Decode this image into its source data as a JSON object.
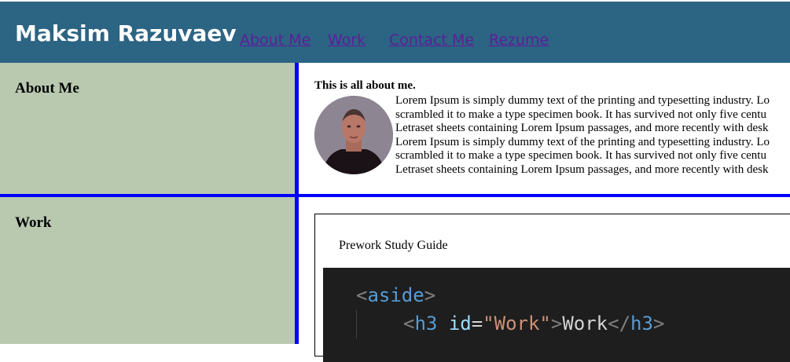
{
  "header": {
    "title": "Maksim Razuvaev",
    "nav": [
      "About Me",
      "Work",
      "Contact Me",
      "Rezume"
    ]
  },
  "about": {
    "heading": "About Me",
    "intro": "This is all about me.",
    "lines": [
      "Lorem Ipsum is simply dummy text of the printing and typesetting industry. Lo",
      "scrambled it to make a type specimen book. It has survived not only five centu",
      "Letraset sheets containing Lorem Ipsum passages, and more recently with desk",
      "Lorem Ipsum is simply dummy text of the printing and typesetting industry. Lo",
      "scrambled it to make a type specimen book. It has survived not only five centu",
      "Letraset sheets containing Lorem Ipsum passages, and more recently with desk"
    ]
  },
  "work": {
    "heading": "Work",
    "card_title": "Prework Study Guide",
    "code": {
      "line1_open": "<",
      "line1_tag": "aside",
      "line1_close": ">",
      "line2_open": "<",
      "line2_tag": "h3",
      "line2_attr": "id",
      "line2_eq": "=",
      "line2_val": "\"Work\"",
      "line2_gt": ">",
      "line2_text": "Work",
      "line2_endopen": "</",
      "line2_endtag": "h3",
      "line2_endgt": ">"
    }
  },
  "colors": {
    "header_bg": "#2c6483",
    "aside_bg": "#b9c9b0",
    "divider": "#0000ff",
    "link": "#5b1f9b"
  }
}
